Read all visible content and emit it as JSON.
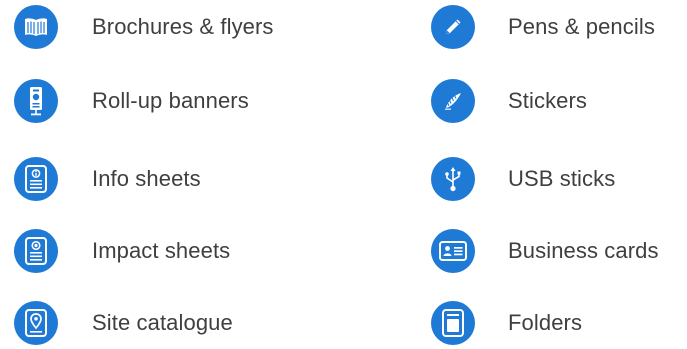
{
  "left_column": [
    {
      "label": "Brochures & flyers",
      "icon": "brochure-icon"
    },
    {
      "label": "Roll-up banners",
      "icon": "rollup-banner-icon"
    },
    {
      "label": "Info sheets",
      "icon": "info-sheet-icon"
    },
    {
      "label": "Impact sheets",
      "icon": "impact-sheet-icon"
    },
    {
      "label": "Site catalogue",
      "icon": "site-catalogue-icon"
    }
  ],
  "right_column": [
    {
      "label": "Pens & pencils",
      "icon": "pen-icon"
    },
    {
      "label": "Stickers",
      "icon": "sticker-icon"
    },
    {
      "label": "USB sticks",
      "icon": "usb-icon"
    },
    {
      "label": "Business cards",
      "icon": "business-card-icon"
    },
    {
      "label": "Folders",
      "icon": "folder-icon"
    }
  ],
  "colors": {
    "accent": "#1f7ad6",
    "text": "#3f3f41"
  }
}
